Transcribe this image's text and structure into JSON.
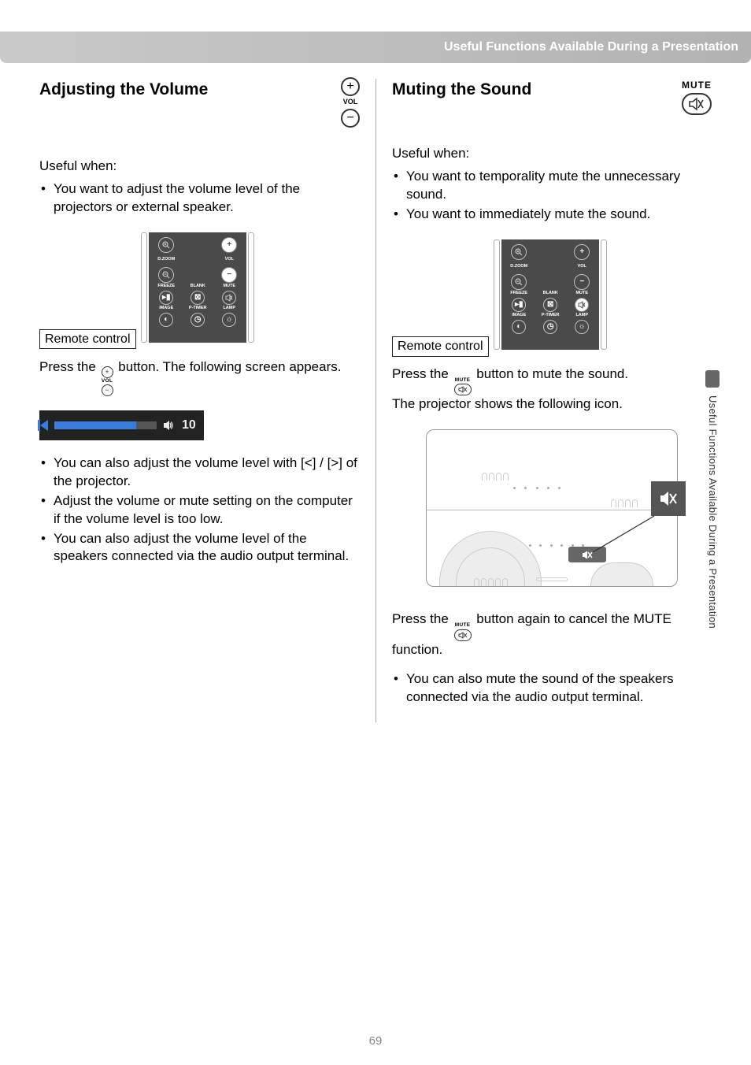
{
  "header": "Useful Functions Available During a Presentation",
  "pageNumber": "69",
  "sideTab": "Useful Functions Available During a Presentation",
  "left": {
    "title": "Adjusting the Volume",
    "headIcon": {
      "plus": "+",
      "label": "VOL",
      "minus": "−"
    },
    "usefulWhen": "Useful when:",
    "intro_bullets": [
      "You want to adjust the volume level of the projectors or external speaker."
    ],
    "remoteLabel": "Remote control",
    "pressStart": "Press the ",
    "pressEnd": " button. The following screen appears.",
    "volumeIndicator": {
      "value": "10"
    },
    "bullets": [
      "You can also adjust the volume level with [<] / [>] of the projector.",
      "Adjust the volume or mute setting on the computer if the volume level is too low.",
      "You can also adjust the volume level of the speakers connected via the audio output terminal."
    ]
  },
  "right": {
    "title": "Muting the Sound",
    "headIcon": {
      "label": "MUTE"
    },
    "usefulWhen": "Useful when:",
    "intro_bullets": [
      "You want to temporality mute the unnecessary sound.",
      "You want to immediately mute the sound."
    ],
    "remoteLabel": "Remote control",
    "pressStart": "Press the ",
    "pressMid1": " button to mute the sound.",
    "pressMid2": "The projector shows the following icon.",
    "press2Start": "Press the ",
    "press2End": " button again to cancel the MUTE function.",
    "bullets": [
      "You can also mute the sound of the speakers connected via the audio output terminal."
    ]
  },
  "remote": {
    "r1c1": "D.ZOOM",
    "r1c3": "VOL",
    "r2c1": "FREEZE",
    "r2c2": "BLANK",
    "r2c3": "MUTE",
    "r3c1": "IMAGE",
    "r3c2": "P-TIMER",
    "r3c3": "LAMP"
  }
}
